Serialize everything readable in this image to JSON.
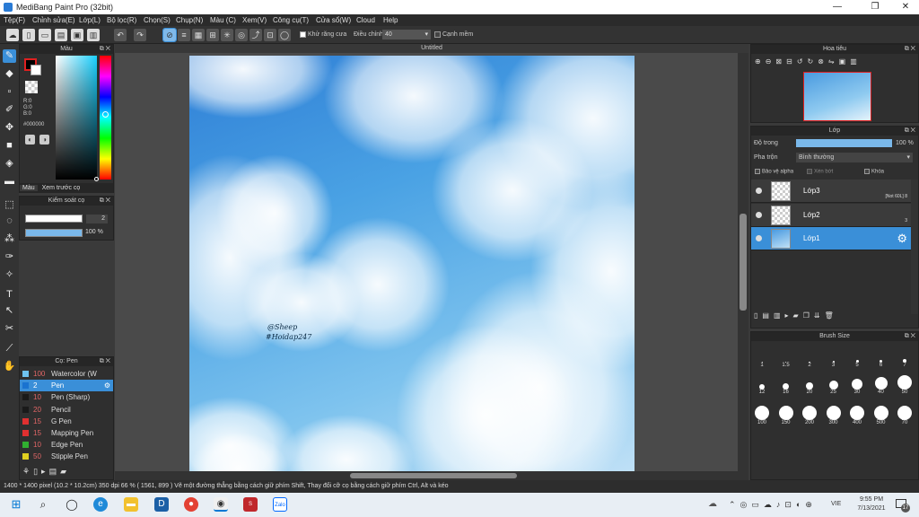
{
  "window": {
    "title": "MediBang Paint Pro (32bit)",
    "min": "—",
    "max": "❐",
    "close": "✕"
  },
  "menu": [
    "Tệp(F)",
    "Chỉnh sửa(E)",
    "Lớp(L)",
    "Bộ lọc(R)",
    "Chọn(S)",
    "Chụp(N)",
    "Màu (C)",
    "Xem(V)",
    "Công cụ(T)",
    "Cửa sổ(W)",
    "Cloud",
    "Help"
  ],
  "toolbar": {
    "antialias_label": "Khử răng cưa",
    "adjust_label": "Điều chỉnh",
    "adjust_value": "40",
    "smooth_label": "Cạnh mềm"
  },
  "color_panel": {
    "title": "Màu",
    "r": "R:0",
    "g": "G:0",
    "b": "B:0",
    "hex": "#000000",
    "tab_color": "Màu",
    "tab_preview": "Xem trước cọ",
    "fg": "#000000",
    "accent": "#e02020"
  },
  "brush_control": {
    "title": "Kiểm soát cọ",
    "size": "2",
    "opacity": "100 %"
  },
  "pen_panel": {
    "title": "Cọ: Pen",
    "items": [
      {
        "size": "100",
        "name": "Watercolor (W",
        "color": "#6fc3f0",
        "selected": false
      },
      {
        "size": "2",
        "name": "Pen",
        "color": "#1a73d0",
        "selected": true
      },
      {
        "size": "10",
        "name": "Pen (Sharp)",
        "color": "#1a1a1a",
        "selected": false
      },
      {
        "size": "20",
        "name": "Pencil",
        "color": "#1a1a1a",
        "selected": false
      },
      {
        "size": "15",
        "name": "G Pen",
        "color": "#e03030",
        "selected": false
      },
      {
        "size": "15",
        "name": "Mapping Pen",
        "color": "#e03030",
        "selected": false
      },
      {
        "size": "10",
        "name": "Edge Pen",
        "color": "#30b030",
        "selected": false
      },
      {
        "size": "50",
        "name": "Stipple Pen",
        "color": "#e0d020",
        "selected": false
      }
    ]
  },
  "document": {
    "tab": "Untitled",
    "signature_line1": "@Sheep",
    "signature_line2": "#Hoidap247"
  },
  "navigator": {
    "title": "Hoa tiêu"
  },
  "layers": {
    "title": "Lớp",
    "opacity_label": "Độ trong",
    "opacity_value": "100 %",
    "opacity_fraction": 1.0,
    "blend_label": "Pha trộn",
    "blend_value": "Bình thường",
    "protect_alpha": "Bảo vệ alpha",
    "clipping": "Xén bớt",
    "lock": "Khóa",
    "items": [
      {
        "name": "Lớp3",
        "note": "[Not 60L] 8",
        "selected": false
      },
      {
        "name": "Lớp2",
        "note": "3",
        "selected": false
      },
      {
        "name": "Lớp1",
        "note": "",
        "selected": true
      }
    ]
  },
  "brush_size": {
    "title": "Brush Size",
    "row1": [
      "1",
      "1.5",
      "2",
      "3",
      "5",
      "6",
      "7"
    ],
    "row2": [
      "12",
      "16",
      "20",
      "25",
      "30",
      "40",
      "50"
    ],
    "row3": [
      "100",
      "150",
      "200",
      "300",
      "400",
      "500",
      "70"
    ]
  },
  "status": {
    "text": "1400 * 1400 pixel   (10.2 * 10.2cm)   350 dpi   66 %   ( 1561, 899 )   Vẽ một đường thẳng bằng cách giữ phím Shift, Thay đổi cỡ cọ bằng cách giữ phím Ctrl, Alt và kéo"
  },
  "taskbar": {
    "time": "9:55 PM",
    "date": "7/13/2021",
    "lang": "VIE",
    "notif": "17"
  }
}
